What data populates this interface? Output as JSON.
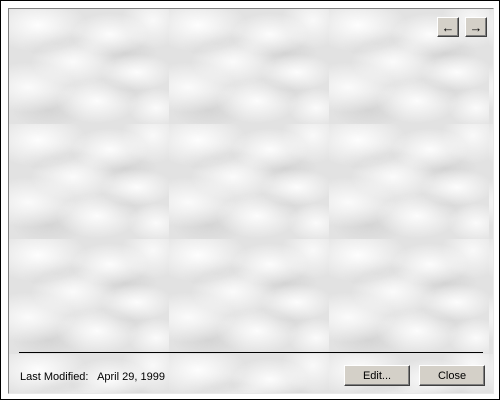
{
  "navigation": {
    "back_glyph": "←",
    "forward_glyph": "→",
    "back_icon": "arrow-left-icon",
    "forward_icon": "arrow-right-icon"
  },
  "footer": {
    "last_modified_label": "Last Modified:",
    "last_modified_date": "April 29, 1999",
    "edit_label": "Edit...",
    "close_label": "Close"
  },
  "colors": {
    "panel_background": "#d4d0c8",
    "divider": "#000000"
  }
}
